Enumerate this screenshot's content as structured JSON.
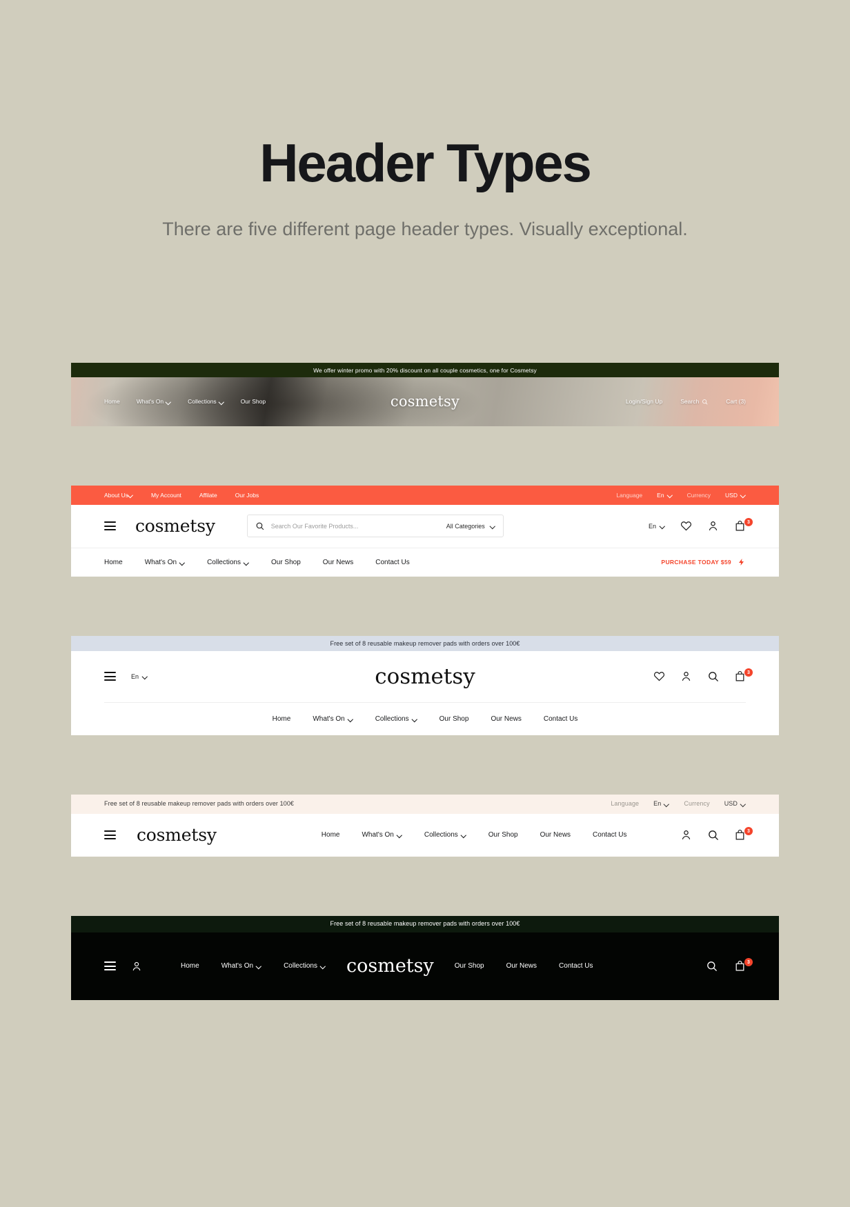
{
  "page": {
    "title": "Header Types",
    "subtitle": "There are five different page header types. Visually exceptional."
  },
  "brand": {
    "name": "cosmetsy"
  },
  "colors": {
    "page_background": "#d0cdbd",
    "accent_orange": "#fb5b41",
    "badge_red": "#f4442b",
    "promo_dark_green": "#1d2b0c",
    "promo_blue_grey": "#d8dee8",
    "promo_cream": "#faf1ea",
    "dark_header": "#030503"
  },
  "promos": {
    "winter": "We offer winter promo with 20% discount on all couple cosmetics, one for Cosmetsy",
    "pads": "Free set of 8 reusable makeup remover pads with orders over 100€"
  },
  "main_nav": [
    {
      "label": "Home",
      "has_dropdown": false
    },
    {
      "label": "What's On",
      "has_dropdown": true
    },
    {
      "label": "Collections",
      "has_dropdown": true
    },
    {
      "label": "Our Shop",
      "has_dropdown": false
    },
    {
      "label": "Our News",
      "has_dropdown": false
    },
    {
      "label": "Contact Us",
      "has_dropdown": false
    }
  ],
  "header1": {
    "promo": "We offer winter promo with 20% discount on all couple cosmetics, one for Cosmetsy",
    "nav": [
      {
        "label": "Home",
        "has_dropdown": false
      },
      {
        "label": "What's On",
        "has_dropdown": true
      },
      {
        "label": "Collections",
        "has_dropdown": true
      },
      {
        "label": "Our Shop",
        "has_dropdown": false
      }
    ],
    "logo": "cosmetsy",
    "login": "Login/Sign Up",
    "search": "Search",
    "cart": "Cart (3)"
  },
  "header2": {
    "topbar_left": [
      {
        "label": "About Us",
        "has_dropdown": true
      },
      {
        "label": "My Account",
        "has_dropdown": false
      },
      {
        "label": "Affilate",
        "has_dropdown": false
      },
      {
        "label": "Our Jobs",
        "has_dropdown": false
      }
    ],
    "language_label": "Language",
    "language_value": "En",
    "currency_label": "Currency",
    "currency_value": "USD",
    "logo": "cosmetsy",
    "search_placeholder": "Search Our Favorite Products...",
    "categories_value": "All Categories",
    "lang_value": "En",
    "cart_count": "3",
    "cta": "PURCHASE TODAY $59"
  },
  "header3": {
    "promo": "Free set of 8 reusable makeup remover pads with orders over 100€",
    "lang_value": "En",
    "logo": "cosmetsy",
    "cart_count": "3"
  },
  "header4": {
    "promo": "Free set of 8 reusable makeup remover pads with orders over 100€",
    "language_label": "Language",
    "language_value": "En",
    "currency_label": "Currency",
    "currency_value": "USD",
    "logo": "cosmetsy",
    "cart_count": "3"
  },
  "header5": {
    "promo": "Free set of 8 reusable makeup remover pads with orders over 100€",
    "logo": "cosmetsy",
    "nav_left": [
      {
        "label": "Home",
        "has_dropdown": false
      },
      {
        "label": "What's On",
        "has_dropdown": true
      },
      {
        "label": "Collections",
        "has_dropdown": true
      }
    ],
    "nav_right": [
      {
        "label": "Our Shop",
        "has_dropdown": false
      },
      {
        "label": "Our News",
        "has_dropdown": false
      },
      {
        "label": "Contact Us",
        "has_dropdown": false
      }
    ],
    "cart_count": "3"
  },
  "icons": {
    "menu": "hamburger-icon",
    "search": "search-icon",
    "heart": "heart-icon",
    "user": "user-icon",
    "bag": "shopping-bag-icon",
    "chevron": "chevron-down-icon",
    "bolt": "lightning-bolt-icon"
  }
}
